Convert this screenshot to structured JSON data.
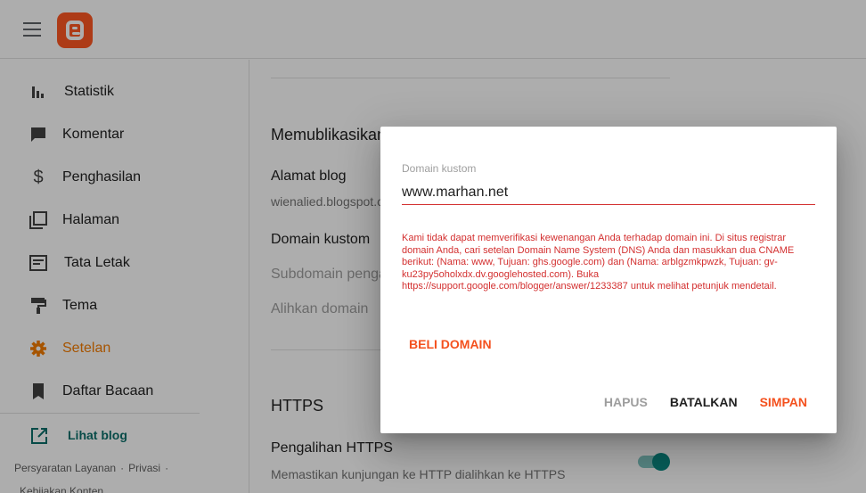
{
  "sidebar": {
    "items": [
      {
        "label": "Statistik",
        "icon": "bar-chart-icon"
      },
      {
        "label": "Komentar",
        "icon": "comment-icon"
      },
      {
        "label": "Penghasilan",
        "icon": "dollar-icon"
      },
      {
        "label": "Halaman",
        "icon": "pages-icon"
      },
      {
        "label": "Tata Letak",
        "icon": "layout-icon"
      },
      {
        "label": "Tema",
        "icon": "paint-roller-icon"
      },
      {
        "label": "Setelan",
        "icon": "gear-icon",
        "active": true
      },
      {
        "label": "Daftar Bacaan",
        "icon": "bookmark-icon"
      }
    ],
    "view_blog": "Lihat blog",
    "footer": {
      "terms": "Persyaratan Layanan",
      "privacy": "Privasi",
      "content_policy": "Kebijakan Konten",
      "separator": "·"
    }
  },
  "main": {
    "publish_title": "Memublikasikan",
    "blog_address_label": "Alamat blog",
    "blog_address_value": "wienalied.blogspot.com",
    "custom_domain_label": "Domain kustom",
    "subdomain_label": "Subdomain pengalihan",
    "redirect_label": "Alihkan domain",
    "https_title": "HTTPS",
    "https_redirect_label": "Pengalihan HTTPS",
    "https_redirect_desc": "Memastikan kunjungan ke HTTP dialihkan ke HTTPS",
    "https_redirect_on": true
  },
  "dialog": {
    "field_label": "Domain kustom",
    "field_value": "www.marhan.net",
    "error": "Kami tidak dapat memverifikasi kewenangan Anda terhadap domain ini. Di situs registrar domain Anda, cari setelan Domain Name System (DNS) Anda dan masukkan dua CNAME berikut: (Nama: www, Tujuan: ghs.google.com) dan (Nama: arblgzmkpwzk, Tujuan: gv-ku23py5oholxdx.dv.googlehosted.com). Buka https://support.google.com/blogger/answer/1233387 untuk melihat petunjuk mendetail.",
    "buy_domain": "BELI DOMAIN",
    "delete": "HAPUS",
    "cancel": "BATALKAN",
    "save": "SIMPAN"
  },
  "colors": {
    "accent": "#f4511e",
    "active_nav": "#f57c00",
    "error": "#d32f2f",
    "teal": "#0b8a84"
  }
}
